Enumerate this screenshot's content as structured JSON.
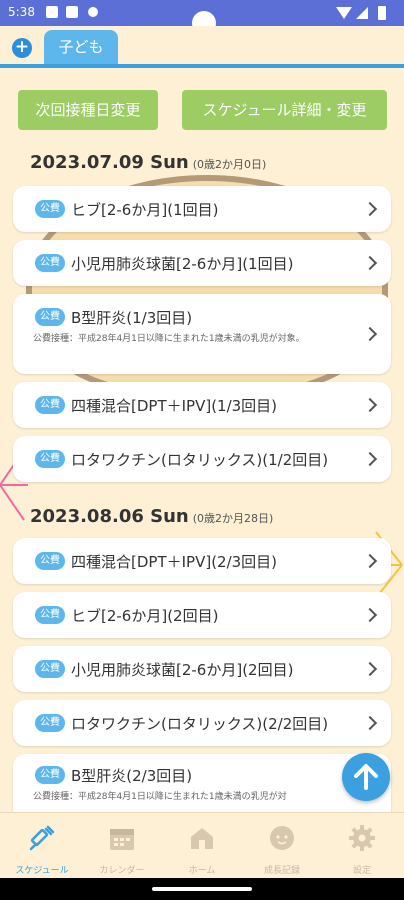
{
  "status_bar": {
    "time": "5:38"
  },
  "tabs": {
    "add_label": "+",
    "active_tab": "子ども"
  },
  "buttons": {
    "change_next_date": "次回接種日変更",
    "schedule_detail": "スケジュール詳細・変更"
  },
  "groups": [
    {
      "date": "2023.07.09 Sun",
      "age": "(0歳2か月0日)",
      "items": [
        {
          "badge": "公費",
          "title": "ヒブ[2-6か月](1回目)"
        },
        {
          "badge": "公費",
          "title": "小児用肺炎球菌[2-6か月](1回目)"
        },
        {
          "badge": "公費",
          "title": "B型肝炎(1/3回目)",
          "note": "公費接種：平成28年4月1日以降に生まれた1歳未満の乳児が対象。"
        },
        {
          "badge": "公費",
          "title": "四種混合[DPT＋IPV](1/3回目)"
        },
        {
          "badge": "公費",
          "title": "ロタワクチン(ロタリックス)(1/2回目)"
        }
      ]
    },
    {
      "date": "2023.08.06 Sun",
      "age": "(0歳2か月28日)",
      "items": [
        {
          "badge": "公費",
          "title": "四種混合[DPT＋IPV](2/3回目)"
        },
        {
          "badge": "公費",
          "title": "ヒブ[2-6か月](2回目)"
        },
        {
          "badge": "公費",
          "title": "小児用肺炎球菌[2-6か月](2回目)"
        },
        {
          "badge": "公費",
          "title": "ロタワクチン(ロタリックス)(2/2回目)"
        },
        {
          "badge": "公費",
          "title": "B型肝炎(2/3回目)",
          "note": "公費接種：平成28年4月1日以降に生まれた1歳未満の乳児が対"
        }
      ]
    }
  ],
  "bottom_nav": [
    {
      "label": "スケジュール",
      "icon": "syringe-icon",
      "active": true
    },
    {
      "label": "カレンダー",
      "icon": "calendar-icon",
      "active": false
    },
    {
      "label": "ホーム",
      "icon": "home-icon",
      "active": false
    },
    {
      "label": "成長記録",
      "icon": "baby-face-icon",
      "active": false
    },
    {
      "label": "設定",
      "icon": "gear-icon",
      "active": false
    }
  ],
  "colors": {
    "accent": "#3aa0e0",
    "button_green": "#9ccc63",
    "background": "#fdf0d5",
    "status_bar": "#5c6fd6"
  }
}
